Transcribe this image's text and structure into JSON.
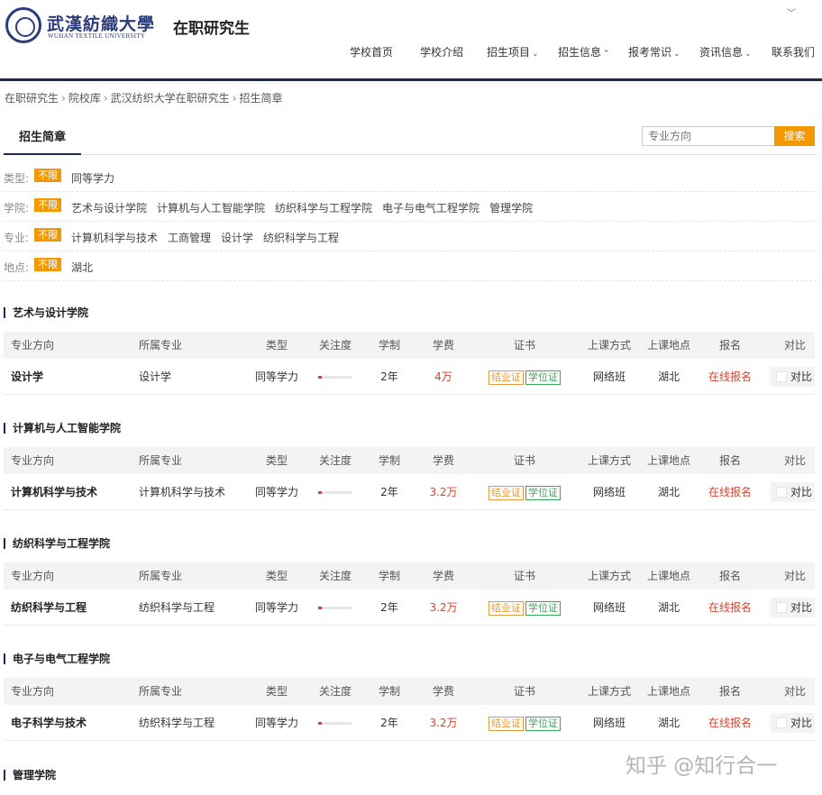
{
  "header": {
    "logo_cn": "武漢紡織大學",
    "logo_en": "WUHAN TEXTILE UNIVERSITY",
    "site_title": "在职研究生",
    "nav": [
      {
        "label": "学校首页",
        "caret": ""
      },
      {
        "label": "学校介绍",
        "caret": ""
      },
      {
        "label": "招生项目",
        "caret": "⌄"
      },
      {
        "label": "招生信息",
        "caret": "⌃"
      },
      {
        "label": "报考常识",
        "caret": "⌄"
      },
      {
        "label": "资讯信息",
        "caret": "⌄"
      },
      {
        "label": "联系我们",
        "caret": ""
      }
    ]
  },
  "breadcrumb": [
    "在职研究生",
    "院校库",
    "武汉纺织大学在职研究生",
    "招生简章"
  ],
  "tab": {
    "active_label": "招生简章"
  },
  "search": {
    "placeholder": "专业方向",
    "button": "搜索"
  },
  "filters": [
    {
      "label": "类型:",
      "all": "不限",
      "options": [
        "同等学力"
      ]
    },
    {
      "label": "学院:",
      "all": "不限",
      "options": [
        "艺术与设计学院",
        "计算机与人工智能学院",
        "纺织科学与工程学院",
        "电子与电气工程学院",
        "管理学院"
      ]
    },
    {
      "label": "专业:",
      "all": "不限",
      "options": [
        "计算机科学与技术",
        "工商管理",
        "设计学",
        "纺织科学与工程"
      ]
    },
    {
      "label": "地点:",
      "all": "不限",
      "options": [
        "湖北"
      ]
    }
  ],
  "table_headers": {
    "direction": "专业方向",
    "major": "所属专业",
    "type": "类型",
    "attention": "关注度",
    "duration": "学制",
    "fee": "学费",
    "certificate": "证书",
    "mode": "上课方式",
    "location": "上课地点",
    "register": "报名",
    "compare": "对比"
  },
  "sections": [
    {
      "title": "艺术与设计学院",
      "row": {
        "direction": "设计学",
        "major": "设计学",
        "type": "同等学力",
        "attention": 0.12,
        "duration": "2年",
        "fee": "4万",
        "cert_grad": "结业证",
        "cert_degree": "学位证",
        "mode": "网络班",
        "location": "湖北",
        "register": "在线报名",
        "compare": "对比"
      }
    },
    {
      "title": "计算机与人工智能学院",
      "row": {
        "direction": "计算机科学与技术",
        "major": "计算机科学与技术",
        "type": "同等学力",
        "attention": 0.12,
        "duration": "2年",
        "fee": "3.2万",
        "cert_grad": "结业证",
        "cert_degree": "学位证",
        "mode": "网络班",
        "location": "湖北",
        "register": "在线报名",
        "compare": "对比"
      }
    },
    {
      "title": "纺织科学与工程学院",
      "row": {
        "direction": "纺织科学与工程",
        "major": "纺织科学与工程",
        "type": "同等学力",
        "attention": 0.12,
        "duration": "2年",
        "fee": "3.2万",
        "cert_grad": "结业证",
        "cert_degree": "学位证",
        "mode": "网络班",
        "location": "湖北",
        "register": "在线报名",
        "compare": "对比"
      }
    },
    {
      "title": "电子与电气工程学院",
      "row": {
        "direction": "电子科学与技术",
        "major": "纺织科学与工程",
        "type": "同等学力",
        "attention": 0.12,
        "duration": "2年",
        "fee": "3.2万",
        "cert_grad": "结业证",
        "cert_degree": "学位证",
        "mode": "网络班",
        "location": "湖北",
        "register": "在线报名",
        "compare": "对比"
      }
    }
  ],
  "last_section_title": "管理学院",
  "watermark": "知乎 @知行合一",
  "colors": {
    "accent_orange": "#f39800",
    "navy": "#1c2b4f",
    "price_red": "#e0402b",
    "cert_orange": "#e89a3c",
    "cert_green": "#3aa85a"
  },
  "icons": {
    "top_dropdown": "chevron-down-icon"
  }
}
